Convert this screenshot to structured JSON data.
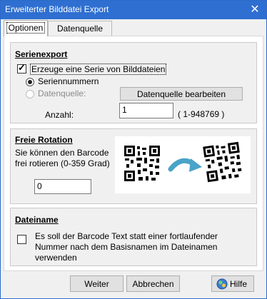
{
  "window": {
    "title": "Erweiterter Bilddatei Export",
    "close_glyph": "✕"
  },
  "tabs": [
    {
      "label": "Optionen",
      "active": true
    },
    {
      "label": "Datenquelle",
      "active": false
    }
  ],
  "series_export": {
    "title": "Serienexport",
    "checkbox_label": "Erzeuge eine Serie von Bilddateien",
    "checkbox_checked": true,
    "radio_serial_label": "Seriennummern",
    "radio_datasource_label": "Datenquelle:",
    "edit_datasource_button": "Datenquelle bearbeiten",
    "count_label": "Anzahl:",
    "count_value": "1",
    "count_range": "( 1-948769 )"
  },
  "rotation": {
    "title": "Freie Rotation",
    "description_line1": "Sie können den Barcode",
    "description_line2": "frei rotieren (0-359 Grad)",
    "value": "0"
  },
  "filename": {
    "title": "Dateiname",
    "checkbox_label_line1": "Es soll der Barcode Text statt einer fortlaufender",
    "checkbox_label_line2": "Nummer nach dem Basisnamen im Dateinamen",
    "checkbox_label_line3": "verwenden",
    "checkbox_checked": false
  },
  "buttons": {
    "ok": "Weiter",
    "cancel": "Abbrechen",
    "help": "Hilfe"
  },
  "colors": {
    "title_bar": "#2f6fd1",
    "rotate_arrow": "#4aa3c8"
  }
}
